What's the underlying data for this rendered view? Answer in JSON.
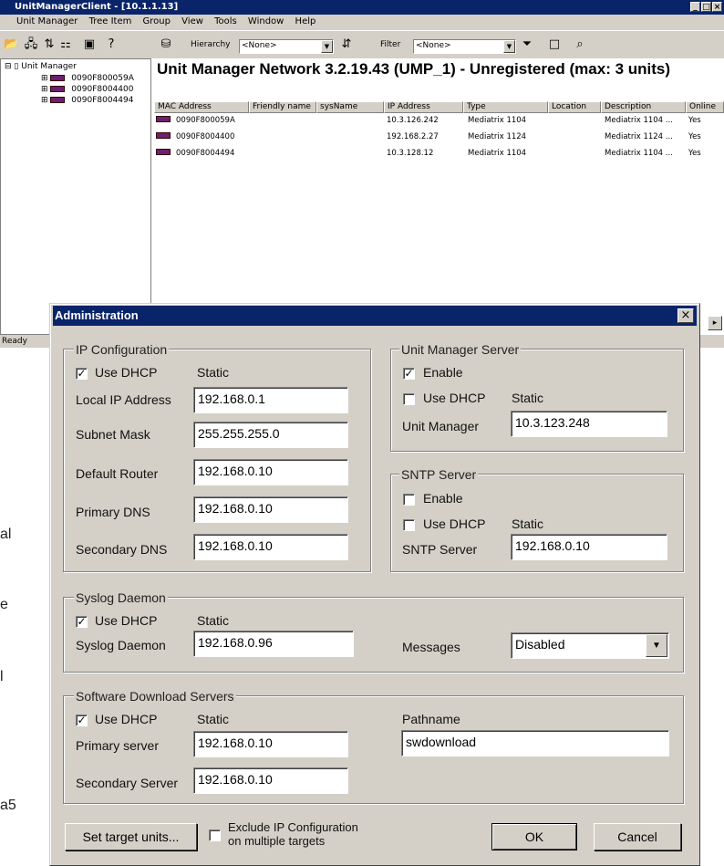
{
  "window": {
    "title": "UnitManagerClient - [10.1.1.13]",
    "menu": [
      "Unit Manager",
      "Tree Item",
      "Group",
      "View",
      "Tools",
      "Window",
      "Help"
    ],
    "status": "Ready"
  },
  "toolbar": {
    "hierarchy_label": "Hierarchy",
    "hierarchy_value": "<None>",
    "filter_label": "Filter",
    "filter_value": "<None>"
  },
  "tree": {
    "root": "Unit Manager",
    "units": [
      "0090F800059A",
      "0090F8004400",
      "0090F8004494"
    ]
  },
  "network": {
    "header": "Unit Manager Network 3.2.19.43 (UMP_1) - Unregistered (max: 3 units)",
    "columns": [
      "MAC Address",
      "Friendly name",
      "sysName",
      "IP Address",
      "Type",
      "Location",
      "Description",
      "Online"
    ],
    "rows": [
      {
        "mac": "0090F800059A",
        "ip": "10.3.126.242",
        "type": "Mediatrix 1104",
        "desc": "Mediatrix 1104 ...",
        "online": "Yes"
      },
      {
        "mac": "0090F8004400",
        "ip": "192.168.2.27",
        "type": "Mediatrix 1124",
        "desc": "Mediatrix 1124 ...",
        "online": "Yes"
      },
      {
        "mac": "0090F8004494",
        "ip": "10.3.128.12",
        "type": "Mediatrix 1104",
        "desc": "Mediatrix 1104 ...",
        "online": "Yes"
      }
    ]
  },
  "background_fragments": [
    "al",
    "e",
    "l",
    "a5"
  ],
  "dialog": {
    "title": "Administration",
    "ip_config": {
      "group": "IP Configuration",
      "use_dhcp": "Use DHCP",
      "static": "Static",
      "local_ip_label": "Local IP Address",
      "local_ip": "192.168.0.1",
      "subnet_label": "Subnet Mask",
      "subnet": "255.255.255.0",
      "router_label": "Default Router",
      "router": "192.168.0.10",
      "pdns_label": "Primary DNS",
      "pdns": "192.168.0.10",
      "sdns_label": "Secondary DNS",
      "sdns": "192.168.0.10"
    },
    "um_server": {
      "group": "Unit Manager Server",
      "enable": "Enable",
      "use_dhcp": "Use DHCP",
      "static": "Static",
      "label": "Unit Manager",
      "value": "10.3.123.248"
    },
    "sntp": {
      "group": "SNTP Server",
      "enable": "Enable",
      "use_dhcp": "Use DHCP",
      "static": "Static",
      "label": "SNTP Server",
      "value": "192.168.0.10"
    },
    "syslog": {
      "group": "Syslog Daemon",
      "use_dhcp": "Use DHCP",
      "static": "Static",
      "label": "Syslog Daemon",
      "value": "192.168.0.96",
      "messages_label": "Messages",
      "messages_value": "Disabled"
    },
    "sw_download": {
      "group": "Software Download Servers",
      "use_dhcp": "Use DHCP",
      "static": "Static",
      "primary_label": "Primary server",
      "primary": "192.168.0.10",
      "secondary_label": "Secondary Server",
      "secondary": "192.168.0.10",
      "pathname_label": "Pathname",
      "pathname": "swdownload"
    },
    "buttons": {
      "set_target": "Set target units...",
      "exclude_line1": "Exclude IP Configuration",
      "exclude_line2": "on multiple targets",
      "ok": "OK",
      "cancel": "Cancel"
    }
  }
}
